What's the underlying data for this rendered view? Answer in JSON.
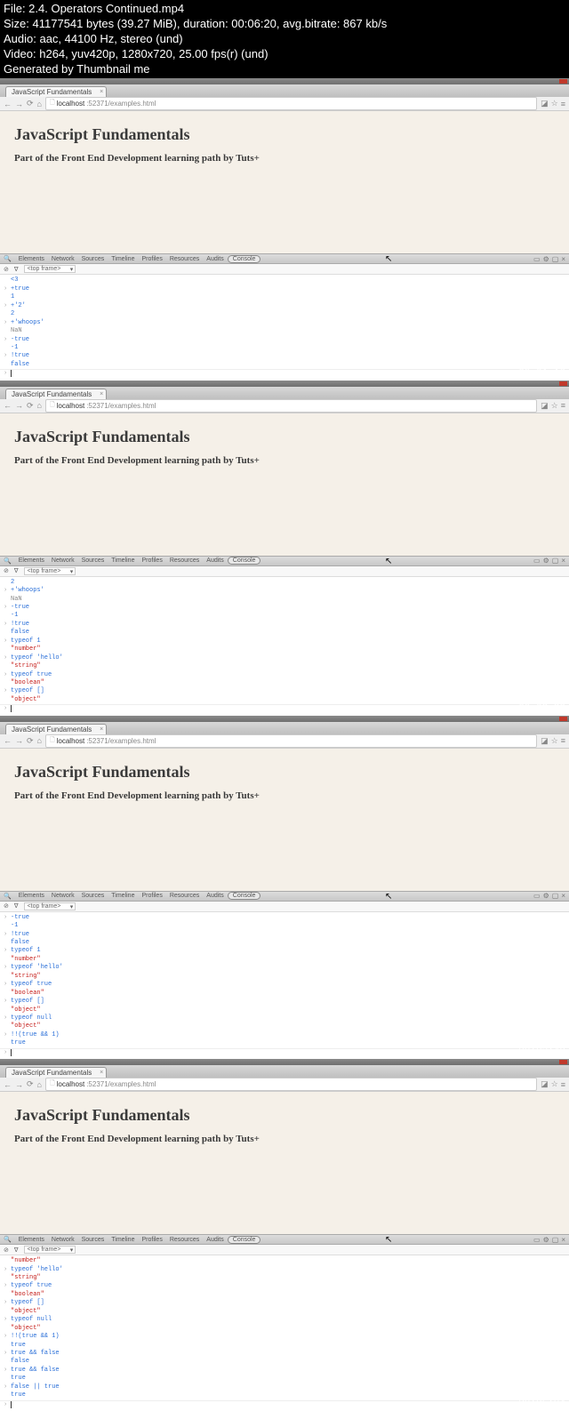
{
  "header": {
    "file": "File: 2.4. Operators Continued.mp4",
    "size": "Size: 41177541 bytes (39.27 MiB), duration: 00:06:20, avg.bitrate: 867 kb/s",
    "audio": "Audio: aac, 44100 Hz, stereo (und)",
    "video": "Video: h264, yuv420p, 1280x720, 25.00 fps(r) (und)",
    "generated": "Generated by Thumbnail me"
  },
  "tab_title": "JavaScript Fundamentals",
  "url_host": "localhost",
  "url_port_path": ":52371/examples.html",
  "page": {
    "title": "JavaScript Fundamentals",
    "subtitle": "Part of the Front End Development learning path by Tuts+"
  },
  "devtools": {
    "tabs": [
      "Elements",
      "Network",
      "Sources",
      "Timeline",
      "Profiles",
      "Resources",
      "Audits",
      "Console"
    ],
    "active_tab": "Console",
    "frame_selector": "<top frame>"
  },
  "shots": [
    {
      "timestamp": "00:01:16",
      "console": [
        {
          "m": "out",
          "t": "<3",
          "cls": "c-number"
        },
        {
          "m": "in",
          "t": "+true",
          "cls": "c-input"
        },
        {
          "m": "out",
          "t": "1",
          "cls": "c-number"
        },
        {
          "m": "in",
          "t": "+'2'",
          "cls": "c-input"
        },
        {
          "m": "out",
          "t": "2",
          "cls": "c-number"
        },
        {
          "m": "in",
          "t": "+'whoops'",
          "cls": "c-input"
        },
        {
          "m": "out",
          "t": "NaN",
          "cls": "c-nan"
        },
        {
          "m": "in",
          "t": "-true",
          "cls": "c-input"
        },
        {
          "m": "out",
          "t": "-1",
          "cls": "c-number"
        },
        {
          "m": "in",
          "t": "!true",
          "cls": "c-input"
        },
        {
          "m": "out",
          "t": "false",
          "cls": "c-bool"
        }
      ]
    },
    {
      "timestamp": "00:02:32",
      "console": [
        {
          "m": "out",
          "t": "2",
          "cls": "c-number"
        },
        {
          "m": "in",
          "t": "+'whoops'",
          "cls": "c-input"
        },
        {
          "m": "out",
          "t": "NaN",
          "cls": "c-nan"
        },
        {
          "m": "in",
          "t": "-true",
          "cls": "c-input"
        },
        {
          "m": "out",
          "t": "-1",
          "cls": "c-number"
        },
        {
          "m": "in",
          "t": "!true",
          "cls": "c-input"
        },
        {
          "m": "out",
          "t": "false",
          "cls": "c-bool"
        },
        {
          "m": "in",
          "t": "typeof 1",
          "cls": "c-input"
        },
        {
          "m": "out",
          "t": "\"number\"",
          "cls": "c-string"
        },
        {
          "m": "in",
          "t": "typeof 'hello'",
          "cls": "c-input"
        },
        {
          "m": "out",
          "t": "\"string\"",
          "cls": "c-string"
        },
        {
          "m": "in",
          "t": "typeof true",
          "cls": "c-input"
        },
        {
          "m": "out",
          "t": "\"boolean\"",
          "cls": "c-string"
        },
        {
          "m": "in",
          "t": "typeof []",
          "cls": "c-input"
        },
        {
          "m": "out",
          "t": "\"object\"",
          "cls": "c-string"
        }
      ]
    },
    {
      "timestamp": "00:03:48",
      "console": [
        {
          "m": "in",
          "t": "-true",
          "cls": "c-input"
        },
        {
          "m": "out",
          "t": "-1",
          "cls": "c-number"
        },
        {
          "m": "in",
          "t": "!true",
          "cls": "c-input"
        },
        {
          "m": "out",
          "t": "false",
          "cls": "c-bool"
        },
        {
          "m": "in",
          "t": "typeof 1",
          "cls": "c-input"
        },
        {
          "m": "out",
          "t": "\"number\"",
          "cls": "c-string"
        },
        {
          "m": "in",
          "t": "typeof 'hello'",
          "cls": "c-input"
        },
        {
          "m": "out",
          "t": "\"string\"",
          "cls": "c-string"
        },
        {
          "m": "in",
          "t": "typeof true",
          "cls": "c-input"
        },
        {
          "m": "out",
          "t": "\"boolean\"",
          "cls": "c-string"
        },
        {
          "m": "in",
          "t": "typeof []",
          "cls": "c-input"
        },
        {
          "m": "out",
          "t": "\"object\"",
          "cls": "c-string"
        },
        {
          "m": "in",
          "t": "typeof null",
          "cls": "c-input"
        },
        {
          "m": "out",
          "t": "\"object\"",
          "cls": "c-string"
        },
        {
          "m": "in",
          "t": "!!(true && 1)",
          "cls": "c-input"
        },
        {
          "m": "out",
          "t": "true",
          "cls": "c-bool"
        }
      ]
    },
    {
      "timestamp": "00:05:04",
      "console": [
        {
          "m": "out",
          "t": "\"number\"",
          "cls": "c-string"
        },
        {
          "m": "in",
          "t": "typeof 'hello'",
          "cls": "c-input"
        },
        {
          "m": "out",
          "t": "\"string\"",
          "cls": "c-string"
        },
        {
          "m": "in",
          "t": "typeof true",
          "cls": "c-input"
        },
        {
          "m": "out",
          "t": "\"boolean\"",
          "cls": "c-string"
        },
        {
          "m": "in",
          "t": "typeof []",
          "cls": "c-input"
        },
        {
          "m": "out",
          "t": "\"object\"",
          "cls": "c-string"
        },
        {
          "m": "in",
          "t": "typeof null",
          "cls": "c-input"
        },
        {
          "m": "out",
          "t": "\"object\"",
          "cls": "c-string"
        },
        {
          "m": "in",
          "t": "!!(true && 1)",
          "cls": "c-input"
        },
        {
          "m": "out",
          "t": "true",
          "cls": "c-bool"
        },
        {
          "m": "in",
          "t": "true && false",
          "cls": "c-input"
        },
        {
          "m": "out",
          "t": "false",
          "cls": "c-bool"
        },
        {
          "m": "in",
          "t": "true && false",
          "cls": "c-input"
        },
        {
          "m": "out",
          "t": "true",
          "cls": "c-bool"
        },
        {
          "m": "in",
          "t": "false || true",
          "cls": "c-input"
        },
        {
          "m": "out",
          "t": "true",
          "cls": "c-bool"
        }
      ]
    }
  ]
}
